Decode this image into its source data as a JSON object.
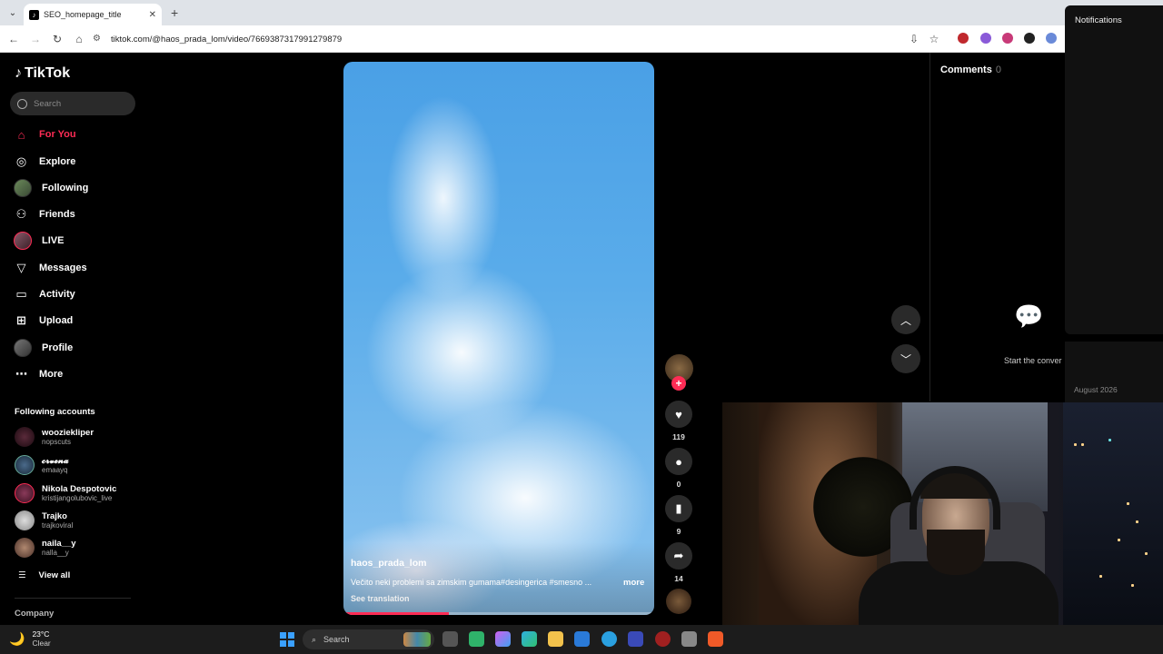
{
  "browser": {
    "tab_title": "SEO_homepage_title",
    "tab_favicon": "♪",
    "url": "tiktok.com/@haos_prada_lom/video/7669387317991279879"
  },
  "notifications": {
    "title": "Notifications",
    "date": "August 2026"
  },
  "sidebar": {
    "logo": "TikTok",
    "search_placeholder": "Search",
    "nav": [
      {
        "label": "For You",
        "icon": "home-icon"
      },
      {
        "label": "Explore",
        "icon": "compass-icon"
      },
      {
        "label": "Following",
        "icon": "avatar"
      },
      {
        "label": "Friends",
        "icon": "friends-icon"
      },
      {
        "label": "LIVE",
        "icon": "avatar"
      },
      {
        "label": "Messages",
        "icon": "send-icon"
      },
      {
        "label": "Activity",
        "icon": "activity-icon"
      },
      {
        "label": "Upload",
        "icon": "plus-square-icon"
      },
      {
        "label": "Profile",
        "icon": "avatar"
      },
      {
        "label": "More",
        "icon": "ellipsis-icon"
      }
    ],
    "following_title": "Following accounts",
    "accounts": [
      {
        "name": "wooziekliper",
        "handle": "nopscuts"
      },
      {
        "name": "𝓬𝓻𝓿𝓮𝓷𝓪",
        "handle": "emaayq"
      },
      {
        "name": "Nikola Despotovic",
        "handle": "kristijangolubovic_live"
      },
      {
        "name": "Trajko",
        "handle": "trajkoviral"
      },
      {
        "name": "naila__y",
        "handle": "nalla__y"
      }
    ],
    "view_all": "View all",
    "company": "Company"
  },
  "video": {
    "author": "haos_prada_lom",
    "description": "Večito neki problemi sa zimskim gumama#desingerica #smesno ...",
    "more": "more",
    "see_translation": "See translation",
    "progress": 0.34
  },
  "actions": {
    "likes": "119",
    "comments": "0",
    "saves": "9",
    "shares": "14"
  },
  "comments": {
    "title": "Comments",
    "count": "0",
    "empty": "Start the conver"
  },
  "taskbar": {
    "temp": "23°C",
    "condition": "Clear",
    "search": "Search"
  },
  "colors": {
    "accent": "#fe2c55"
  }
}
